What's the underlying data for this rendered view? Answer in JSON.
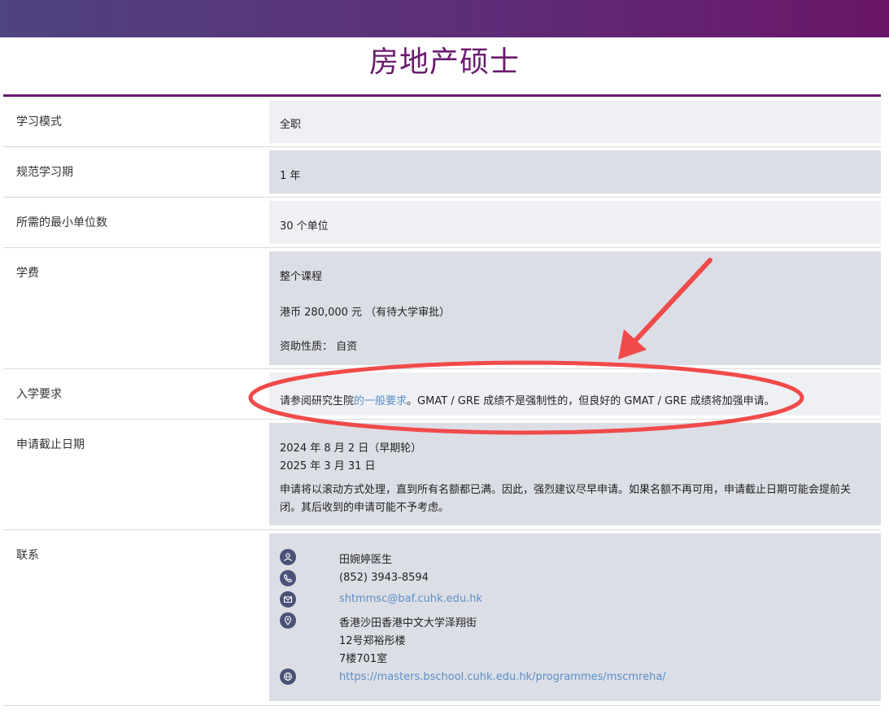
{
  "page": {
    "title": "房地产硕士"
  },
  "rows": {
    "mode": {
      "label": "学习模式",
      "value": "全职"
    },
    "duration": {
      "label": "规范学习期",
      "value": "1 年"
    },
    "units": {
      "label": "所需的最小单位数",
      "value": "30 个单位"
    },
    "fee": {
      "label": "学费",
      "line1": "整个课程",
      "line2": "港币 280,000 元 （有待大学审批）",
      "line3": "资助性质： 自资"
    },
    "admission": {
      "label": "入学要求",
      "prefix": "请参阅研究生院",
      "link": "的一般要求",
      "suffix": "。GMAT / GRE 成绩不是强制性的，但良好的 GMAT / GRE 成绩将加强申请。"
    },
    "deadline": {
      "label": "申请截止日期",
      "date1": "2024 年 8 月 2 日（早期轮）",
      "date2": "2025 年 3 月 31 日",
      "note": "申请将以滚动方式处理，直到所有名额都已满。因此，强烈建议尽早申请。如果名额不再可用，申请截止日期可能会提前关闭。其后收到的申请可能不予考虑。"
    },
    "contact": {
      "label": "联系",
      "name": "田婉婷医生",
      "phone": "(852) 3943-8594",
      "email": "shtmmsc@baf.cuhk.edu.hk",
      "address1": "香港沙田香港中文大学泽翔街",
      "address2": "12号郑裕彤楼",
      "address3": "7楼701室",
      "website": "https://masters.bschool.cuhk.edu.hk/programmes/mscmreha/"
    }
  },
  "colors": {
    "brand": "#6a1b6e",
    "annotation": "#f04a4a",
    "link": "#5b8fc7"
  },
  "icons": {
    "person": "person-icon",
    "phone": "phone-icon",
    "email": "email-icon",
    "location": "location-pin-icon",
    "web": "globe-icon"
  }
}
